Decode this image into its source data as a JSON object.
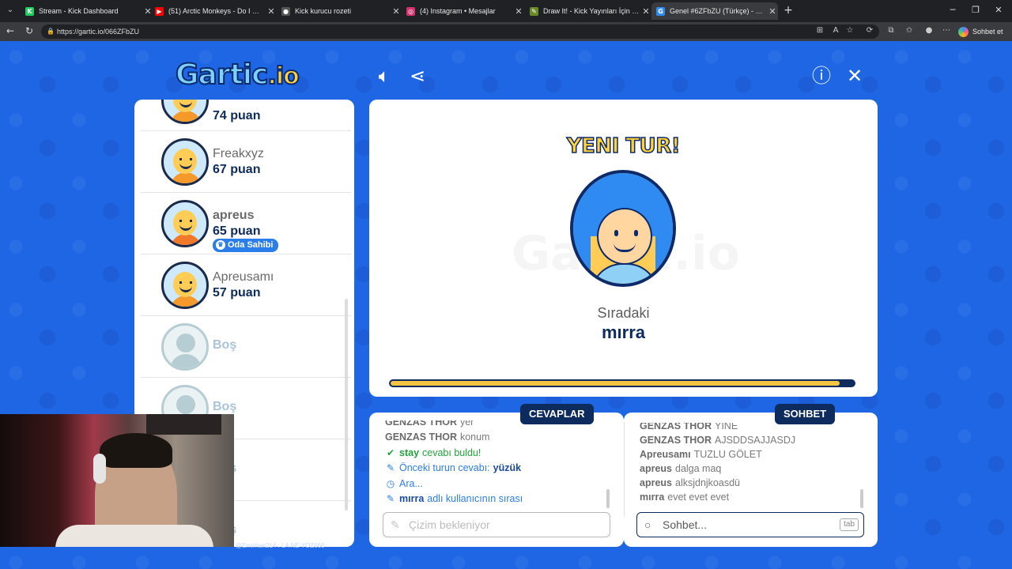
{
  "browser": {
    "tabs": [
      {
        "title": "Stream - Kick Dashboard",
        "favicon_color": "#1fcf5c",
        "favicon_glyph": "K"
      },
      {
        "title": "(51) Arctic Monkeys - Do I Wa...",
        "favicon_color": "#ff0000",
        "favicon_glyph": "▶"
      },
      {
        "title": "Kick kurucu rozeti",
        "favicon_color": "#555555",
        "favicon_glyph": "●"
      },
      {
        "title": "(4) Instagram • Mesajlar",
        "favicon_color": "#d6306f",
        "favicon_glyph": "◎"
      },
      {
        "title": "Draw It! - Kick Yayınları İçin Çizim ...",
        "favicon_color": "#6a8a2a",
        "favicon_glyph": "✎"
      },
      {
        "title": "Genel #6ZFbZU (Türkçe) - Ga...",
        "favicon_color": "#2d8cf0",
        "favicon_glyph": "G"
      }
    ],
    "url": "https://gartic.io/066ZFbZU",
    "copilot_label": "Sohbet et"
  },
  "game": {
    "logo_main": "Gartic",
    "logo_suffix": ".io",
    "players": [
      {
        "name": "",
        "score": "74 puan",
        "avatar_color": "#f59a2a",
        "partial": true
      },
      {
        "name": "Freakxyz",
        "score": "67 puan",
        "avatar_color": "#f59a2a"
      },
      {
        "name": "apreus",
        "score": "65 puan",
        "badge": "Oda Sahibi",
        "avatar_color": "#f07a2a"
      },
      {
        "name": "Apreusamı",
        "score": "57 puan",
        "avatar_color": "#f59a2a"
      },
      {
        "empty_label": "Boş"
      },
      {
        "empty_label": "Boş"
      },
      {
        "empty_label": "Boş"
      },
      {
        "empty_label": "Boş"
      }
    ],
    "board": {
      "headline": "YENI TUR!",
      "watermark": "Gartic.io",
      "next_label": "Sıradaki",
      "next_name": "mırra",
      "progress_fraction": 0.97
    },
    "answers": {
      "tab_label": "CEVAPLAR",
      "messages": [
        {
          "user": "GENZAS THOR",
          "text": "yer",
          "kind": "normal"
        },
        {
          "user": "GENZAS THOR",
          "text": "konum",
          "kind": "normal"
        },
        {
          "user": "stay",
          "text": "cevabı buldu!",
          "kind": "green",
          "icon": "✔"
        },
        {
          "user": "",
          "prefix": "Önceki turun cevabı:",
          "text": "yüzük",
          "kind": "blue",
          "icon": "✎"
        },
        {
          "user": "",
          "prefix": "Ara...",
          "text": "",
          "kind": "blue",
          "icon": "◷"
        },
        {
          "user": "mırra",
          "text": "adlı kullanıcının sırası",
          "kind": "blue",
          "icon": "✎"
        }
      ],
      "input_placeholder": "Çizim bekleniyor"
    },
    "chat": {
      "tab_label": "SOHBET",
      "messages": [
        {
          "user": "GENZAS THOR",
          "text": "YINE"
        },
        {
          "user": "GENZAS THOR",
          "text": "AJSDDSAJJASDJ"
        },
        {
          "user": "Apreusamı",
          "text": "TUZLU GÖLET"
        },
        {
          "user": "apreus",
          "text": "dalga maq"
        },
        {
          "user": "apreus",
          "text": "alksjdnjkoasdü"
        },
        {
          "user": "mırra",
          "text": "evet evet evet"
        }
      ],
      "input_placeholder": "Sohbet...",
      "tab_key": "tab"
    },
    "stream_overlay_text": "@Emirhan214 : LA NE YOZ666"
  }
}
